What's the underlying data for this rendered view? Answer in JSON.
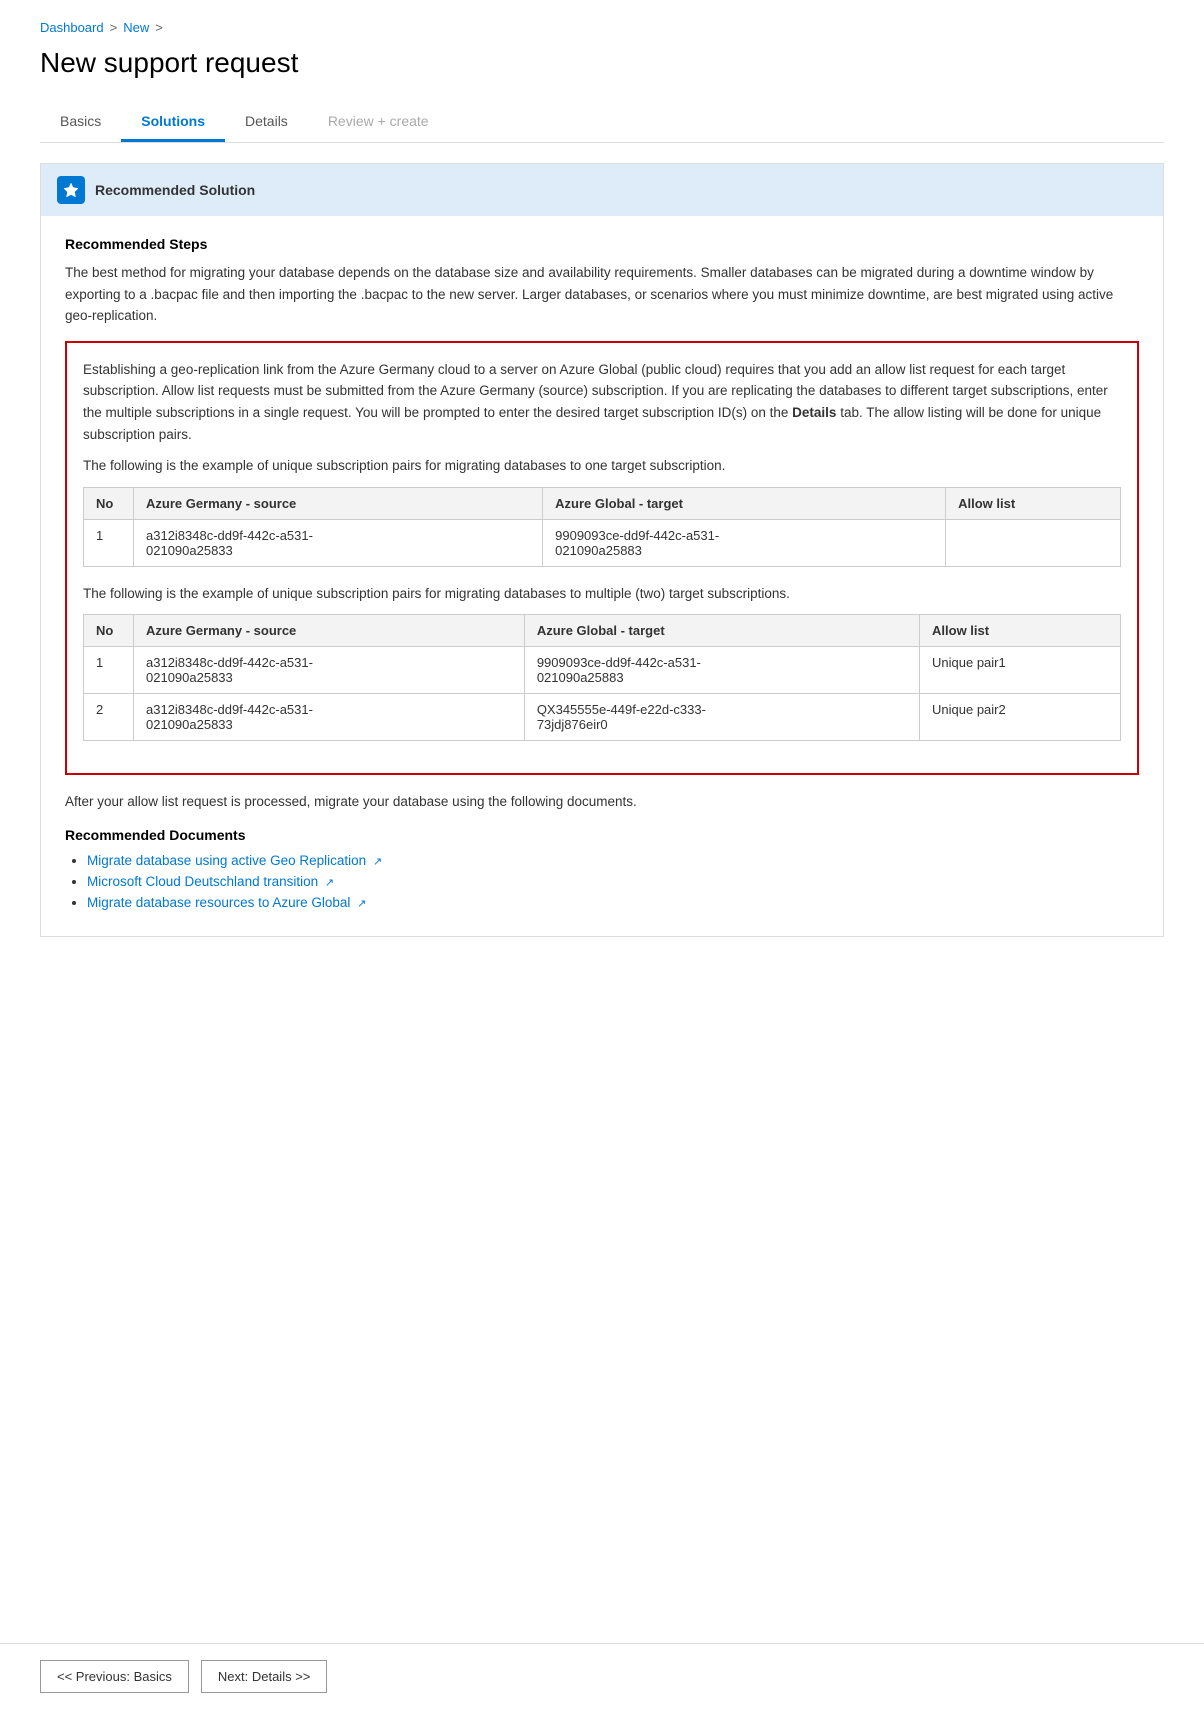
{
  "breadcrumb": {
    "dashboard": "Dashboard",
    "sep1": ">",
    "new": "New",
    "sep2": ">"
  },
  "page_title": "New support request",
  "tabs": [
    {
      "label": "Basics",
      "state": "normal"
    },
    {
      "label": "Solutions",
      "state": "active"
    },
    {
      "label": "Details",
      "state": "normal"
    },
    {
      "label": "Review + create",
      "state": "disabled"
    }
  ],
  "recommended_solution": {
    "header_title": "Recommended Solution",
    "section_title": "Recommended Steps",
    "intro_text": "The best method for migrating your database depends on the database size and availability requirements. Smaller databases can be migrated during a downtime window by exporting to a .bacpac file and then importing the .bacpac to the new server. Larger databases, or scenarios where you must minimize downtime, are best migrated using active geo-replication.",
    "red_box": {
      "para1": "Establishing a geo-replication link from the Azure Germany cloud to a server on Azure Global (public cloud) requires that you add an allow list request for each target subscription. Allow list requests must be submitted from the Azure Germany (source) subscription. If you are replicating the databases to different target subscriptions, enter the multiple subscriptions in a single request. You will be prompted to enter the desired target subscription ID(s) on the",
      "details_bold": "Details",
      "para1_end": "tab. The allow listing will be done for unique subscription pairs.",
      "table1": {
        "caption": "The following is the example of unique subscription pairs for migrating databases to one target subscription.",
        "headers": [
          "No",
          "Azure Germany - source",
          "Azure Global - target",
          "Allow list"
        ],
        "rows": [
          {
            "no": "1",
            "source": "a312i8348c-dd9f-442c-a531-021090a25833",
            "target": "9909093ce-dd9f-442c-a531-021090a25883",
            "allow": ""
          }
        ]
      },
      "table2": {
        "caption": "The following is the example of unique subscription pairs for migrating databases to multiple (two) target subscriptions.",
        "headers": [
          "No",
          "Azure Germany - source",
          "Azure Global - target",
          "Allow list"
        ],
        "rows": [
          {
            "no": "1",
            "source": "a312i8348c-dd9f-442c-a531-021090a25833",
            "target": "9909093ce-dd9f-442c-a531-021090a25883",
            "allow": "Unique pair1"
          },
          {
            "no": "2",
            "source": "a312i8348c-dd9f-442c-a531-021090a25833",
            "target": "QX345555e-449f-e22d-c333-73jdj876eir0",
            "allow": "Unique pair2"
          }
        ]
      }
    },
    "after_text": "After your allow list request is processed, migrate your database using the following documents.",
    "recommended_docs_title": "Recommended Documents",
    "docs": [
      {
        "label": "Migrate database using active Geo Replication",
        "icon": "external-link"
      },
      {
        "label": "Microsoft Cloud Deutschland transition",
        "icon": "external-link"
      },
      {
        "label": "Migrate database resources to Azure Global",
        "icon": "external-link"
      }
    ]
  },
  "footer": {
    "prev_label": "<< Previous: Basics",
    "next_label": "Next: Details >>"
  }
}
